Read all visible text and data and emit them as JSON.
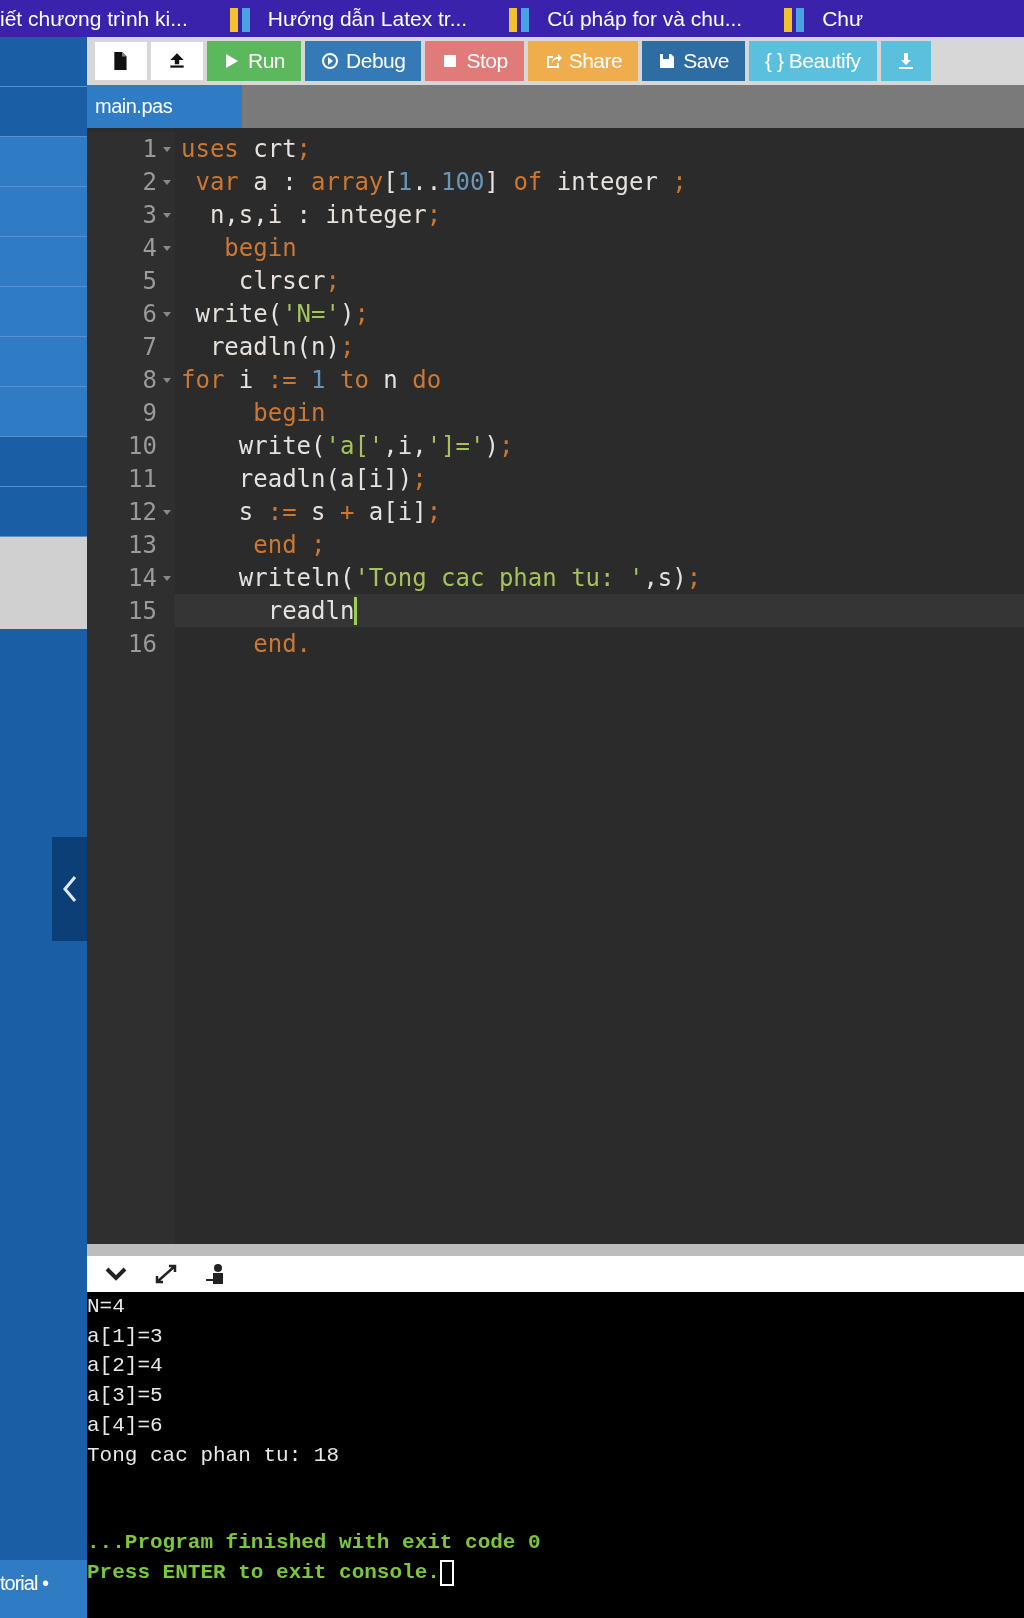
{
  "bookmarks": [
    {
      "text": "iết chương trình ki..."
    },
    {
      "text": "Hướng dẫn Latex tr..."
    },
    {
      "text": "Cú pháp for và chu..."
    },
    {
      "text": "Chư"
    }
  ],
  "toolbar": [
    {
      "kind": "new-file"
    },
    {
      "kind": "upload"
    }
  ],
  "buttons": [
    {
      "kind": "run",
      "label": "Run",
      "color": "#5cb85c"
    },
    {
      "kind": "debug",
      "label": "Debug",
      "color": "#337ab7"
    },
    {
      "kind": "stop",
      "label": "Stop",
      "color": "#e07b7a"
    },
    {
      "kind": "share",
      "label": "Share",
      "color": "#f0ad4e"
    },
    {
      "kind": "save",
      "label": "Save",
      "color": "#2e6da4"
    },
    {
      "kind": "beautify",
      "label": "{ } Beautify",
      "color": "#5bc0de"
    },
    {
      "kind": "download",
      "color": "#5bc0de"
    }
  ],
  "tabs": [
    {
      "label": "main.pas",
      "selected": true
    }
  ],
  "editor": {
    "lines": [
      {
        "number": "1",
        "fold": true,
        "active": false,
        "tokens": [
          {
            "text": "uses",
            "kind": "keyword"
          },
          {
            "text": " crt",
            "kind": "plain"
          },
          {
            "text": ";",
            "kind": "punct"
          }
        ]
      },
      {
        "number": "2",
        "fold": true,
        "active": false,
        "tokens": [
          {
            "text": " var",
            "kind": "keyword"
          },
          {
            "text": " a : ",
            "kind": "plain"
          },
          {
            "text": "array",
            "kind": "keyword"
          },
          {
            "text": "[",
            "kind": "plain"
          },
          {
            "text": "1",
            "kind": "number"
          },
          {
            "text": "..",
            "kind": "plain"
          },
          {
            "text": "100",
            "kind": "number"
          },
          {
            "text": "] ",
            "kind": "plain"
          },
          {
            "text": "of",
            "kind": "keyword"
          },
          {
            "text": " integer ",
            "kind": "plain"
          },
          {
            "text": ";",
            "kind": "punct"
          }
        ]
      },
      {
        "number": "3",
        "fold": true,
        "active": false,
        "tokens": [
          {
            "text": "  n,s,i : integer",
            "kind": "plain"
          },
          {
            "text": ";",
            "kind": "punct"
          }
        ]
      },
      {
        "number": "4",
        "fold": true,
        "active": false,
        "tokens": [
          {
            "text": "   begin",
            "kind": "keyword"
          }
        ]
      },
      {
        "number": "5",
        "fold": false,
        "active": false,
        "tokens": [
          {
            "text": "    clrscr",
            "kind": "plain"
          },
          {
            "text": ";",
            "kind": "punct"
          }
        ]
      },
      {
        "number": "6",
        "fold": true,
        "active": false,
        "tokens": [
          {
            "text": " write(",
            "kind": "plain"
          },
          {
            "text": "'N='",
            "kind": "string"
          },
          {
            "text": ")",
            "kind": "plain"
          },
          {
            "text": ";",
            "kind": "punct"
          }
        ]
      },
      {
        "number": "7",
        "fold": false,
        "active": false,
        "tokens": [
          {
            "text": "  readln(n)",
            "kind": "plain"
          },
          {
            "text": ";",
            "kind": "punct"
          }
        ]
      },
      {
        "number": "8",
        "fold": true,
        "active": false,
        "tokens": [
          {
            "text": "for",
            "kind": "keyword"
          },
          {
            "text": " i ",
            "kind": "plain"
          },
          {
            "text": ":= ",
            "kind": "punct"
          },
          {
            "text": "1",
            "kind": "number"
          },
          {
            "text": " to",
            "kind": "keyword"
          },
          {
            "text": " n ",
            "kind": "plain"
          },
          {
            "text": "do",
            "kind": "keyword"
          }
        ]
      },
      {
        "number": "9",
        "fold": false,
        "active": false,
        "tokens": [
          {
            "text": "     begin",
            "kind": "keyword"
          }
        ]
      },
      {
        "number": "10",
        "fold": false,
        "active": false,
        "tokens": [
          {
            "text": "    write(",
            "kind": "plain"
          },
          {
            "text": "'a['",
            "kind": "string"
          },
          {
            "text": ",i,",
            "kind": "plain"
          },
          {
            "text": "']='",
            "kind": "string"
          },
          {
            "text": ")",
            "kind": "plain"
          },
          {
            "text": ";",
            "kind": "punct"
          }
        ]
      },
      {
        "number": "11",
        "fold": false,
        "active": false,
        "tokens": [
          {
            "text": "    readln(a[i])",
            "kind": "plain"
          },
          {
            "text": ";",
            "kind": "punct"
          }
        ]
      },
      {
        "number": "12",
        "fold": true,
        "active": false,
        "tokens": [
          {
            "text": "    s ",
            "kind": "plain"
          },
          {
            "text": ":=",
            "kind": "punct"
          },
          {
            "text": " s ",
            "kind": "plain"
          },
          {
            "text": "+",
            "kind": "punct"
          },
          {
            "text": " a[i]",
            "kind": "plain"
          },
          {
            "text": ";",
            "kind": "punct"
          }
        ]
      },
      {
        "number": "13",
        "fold": false,
        "active": false,
        "tokens": [
          {
            "text": "     end ;",
            "kind": "keyword"
          }
        ]
      },
      {
        "number": "14",
        "fold": true,
        "active": false,
        "tokens": [
          {
            "text": "    writeln(",
            "kind": "plain"
          },
          {
            "text": "'Tong cac phan tu: '",
            "kind": "string"
          },
          {
            "text": ",s)",
            "kind": "plain"
          },
          {
            "text": ";",
            "kind": "punct"
          }
        ]
      },
      {
        "number": "15",
        "fold": false,
        "active": true,
        "tokens": [
          {
            "text": "      readln",
            "kind": "plain"
          }
        ]
      },
      {
        "number": "16",
        "fold": false,
        "active": false,
        "tokens": [
          {
            "text": "     end.",
            "kind": "keyword"
          }
        ]
      }
    ]
  },
  "sidebar": {
    "footer": "torial •"
  },
  "console": {
    "output": [
      "N=4",
      "a[1]=3",
      "a[2]=4",
      "a[3]=5",
      "a[4]=6",
      "Tong cac phan tu: 18"
    ],
    "status": [
      "...Program finished with exit code 0",
      "Press ENTER to exit console."
    ]
  }
}
